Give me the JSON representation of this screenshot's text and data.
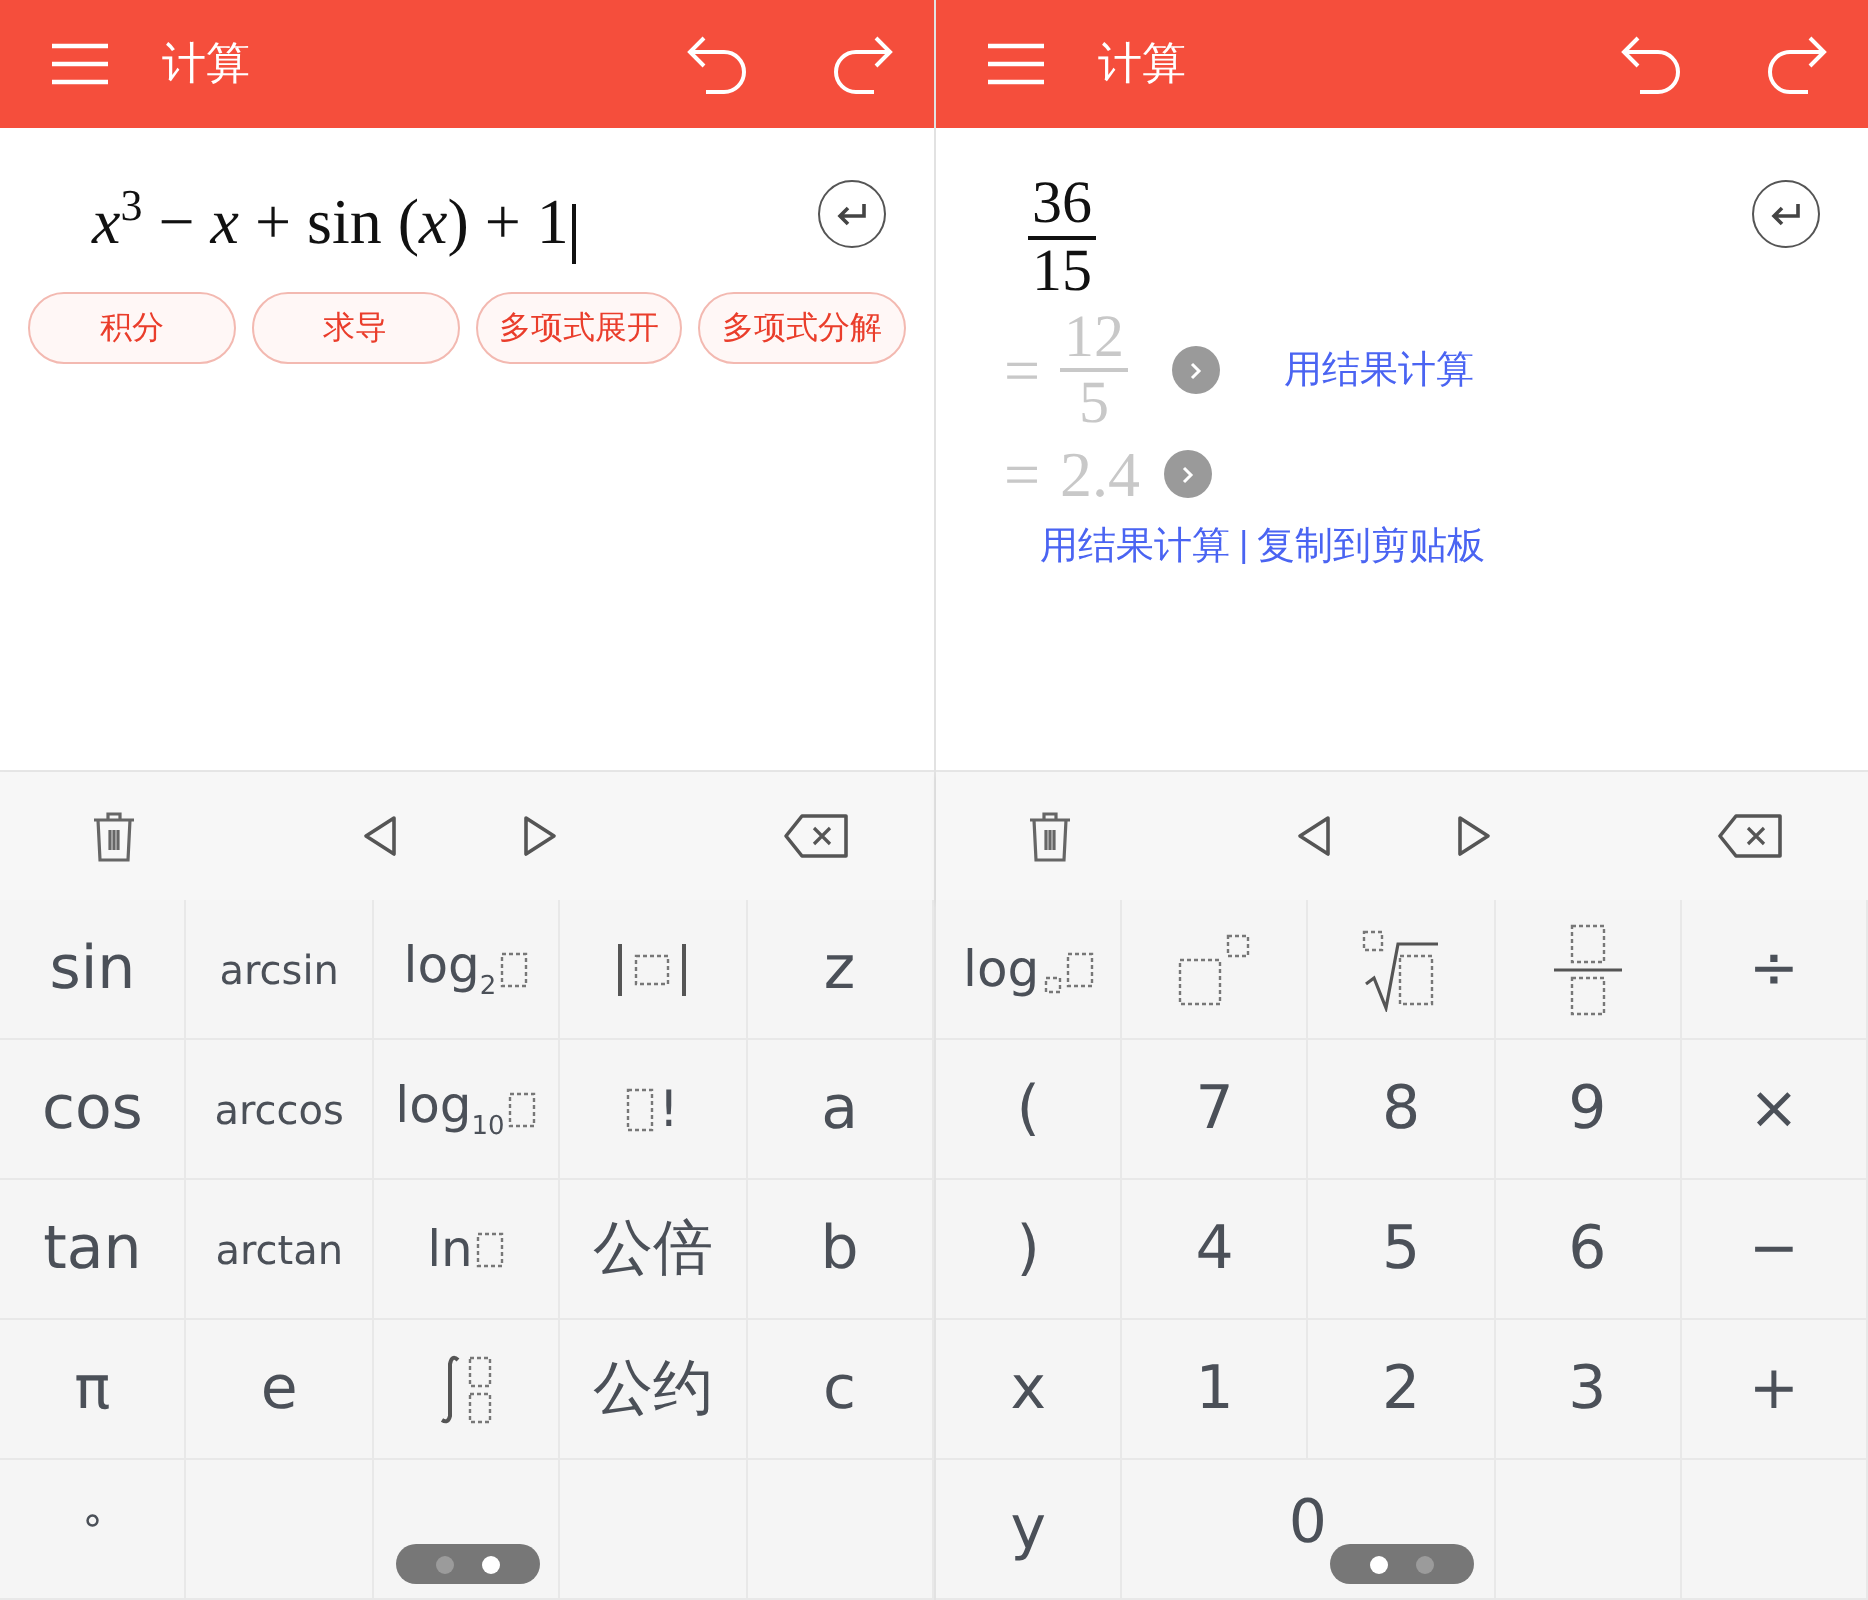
{
  "left": {
    "title": "计算",
    "input": {
      "expression": "*x*$^{3}$ − *x* + sin (*x*) + 1",
      "cursor": true
    },
    "actions": [
      "积分",
      "求导",
      "多项式展开",
      "多项式分解"
    ],
    "keypad": {
      "page_dots": [
        {
          "selected": false
        },
        {
          "selected": true
        }
      ],
      "keys": [
        {
          "kind": "text",
          "label": "sin"
        },
        {
          "kind": "small",
          "label": "arcsin"
        },
        {
          "kind": "fn-slot",
          "label": "log$_{2}$"
        },
        {
          "kind": "abs"
        },
        {
          "kind": "text",
          "label": "z"
        },
        {
          "kind": "text",
          "label": "cos"
        },
        {
          "kind": "small",
          "label": "arccos"
        },
        {
          "kind": "fn-slot",
          "label": "log$_{10}$"
        },
        {
          "kind": "factorial",
          "label": "!"
        },
        {
          "kind": "text",
          "label": "a"
        },
        {
          "kind": "text",
          "label": "tan"
        },
        {
          "kind": "small",
          "label": "arctan"
        },
        {
          "kind": "fn-slot",
          "label": "ln"
        },
        {
          "kind": "text",
          "label": "公倍"
        },
        {
          "kind": "text",
          "label": "b"
        },
        {
          "kind": "text",
          "label": "π"
        },
        {
          "kind": "text",
          "label": "e"
        },
        {
          "kind": "integral"
        },
        {
          "kind": "text",
          "label": "公约"
        },
        {
          "kind": "text",
          "label": "c"
        },
        {
          "kind": "small",
          "label": "°"
        },
        {
          "kind": "empty"
        },
        {
          "kind": "empty"
        },
        {
          "kind": "empty"
        },
        {
          "kind": "empty"
        }
      ]
    }
  },
  "right": {
    "title": "计算",
    "result": {
      "numerator": "36",
      "denominator": "15"
    },
    "steps": [
      {
        "kind": "fraction",
        "equals": "=",
        "numerator": "12",
        "denominator": "5",
        "link": "用结果计算"
      },
      {
        "kind": "decimal",
        "equals": "=",
        "value": "2.4"
      }
    ],
    "links": [
      "用结果计算",
      "复制到剪贴板"
    ],
    "separator": "|",
    "keypad": {
      "page_dots": [
        {
          "selected": true
        },
        {
          "selected": false
        }
      ],
      "keys": [
        {
          "kind": "log-base",
          "label": "log"
        },
        {
          "kind": "power"
        },
        {
          "kind": "root"
        },
        {
          "kind": "fraction"
        },
        {
          "kind": "text",
          "label": "÷"
        },
        {
          "kind": "text",
          "label": "("
        },
        {
          "kind": "text",
          "label": "7"
        },
        {
          "kind": "text",
          "label": "8"
        },
        {
          "kind": "text",
          "label": "9"
        },
        {
          "kind": "text",
          "label": "×"
        },
        {
          "kind": "text",
          "label": ")"
        },
        {
          "kind": "text",
          "label": "4"
        },
        {
          "kind": "text",
          "label": "5"
        },
        {
          "kind": "text",
          "label": "6"
        },
        {
          "kind": "text",
          "label": "−"
        },
        {
          "kind": "text",
          "label": "x"
        },
        {
          "kind": "text",
          "label": "1"
        },
        {
          "kind": "text",
          "label": "2"
        },
        {
          "kind": "text",
          "label": "3"
        },
        {
          "kind": "text",
          "label": "+"
        },
        {
          "kind": "text",
          "label": "y"
        },
        {
          "kind": "wide",
          "label": "0"
        },
        {
          "kind": "empty"
        },
        {
          "kind": "empty"
        }
      ]
    }
  }
}
